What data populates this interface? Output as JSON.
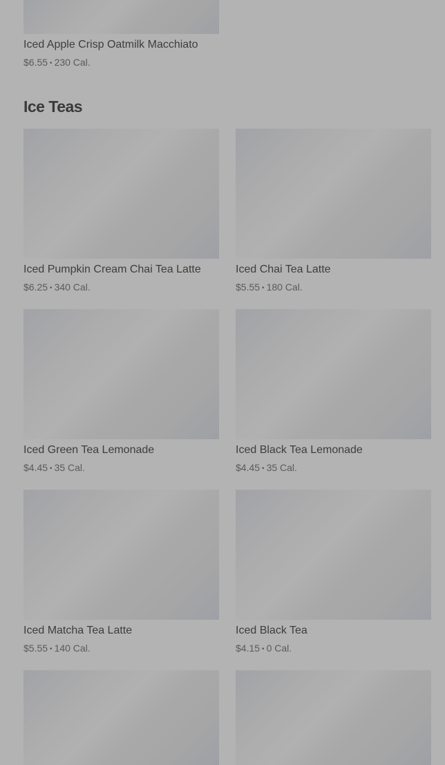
{
  "previous_item": {
    "name": "Iced Apple Crisp Oatmilk Macchiato",
    "price": "$6.55",
    "calories": "230 Cal."
  },
  "section": {
    "title": "Ice Teas",
    "items": [
      {
        "name": "Iced Pumpkin Cream Chai Tea Latte",
        "price": "$6.25",
        "calories": "340 Cal."
      },
      {
        "name": "Iced Chai Tea Latte",
        "price": "$5.55",
        "calories": "180 Cal."
      },
      {
        "name": "Iced Green Tea Lemonade",
        "price": "$4.45",
        "calories": "35 Cal."
      },
      {
        "name": "Iced Black Tea Lemonade",
        "price": "$4.45",
        "calories": "35 Cal."
      },
      {
        "name": "Iced Matcha Tea Latte",
        "price": "$5.55",
        "calories": "140 Cal."
      },
      {
        "name": "Iced Black Tea",
        "price": "$4.15",
        "calories": "0 Cal."
      }
    ]
  },
  "separator": "•"
}
